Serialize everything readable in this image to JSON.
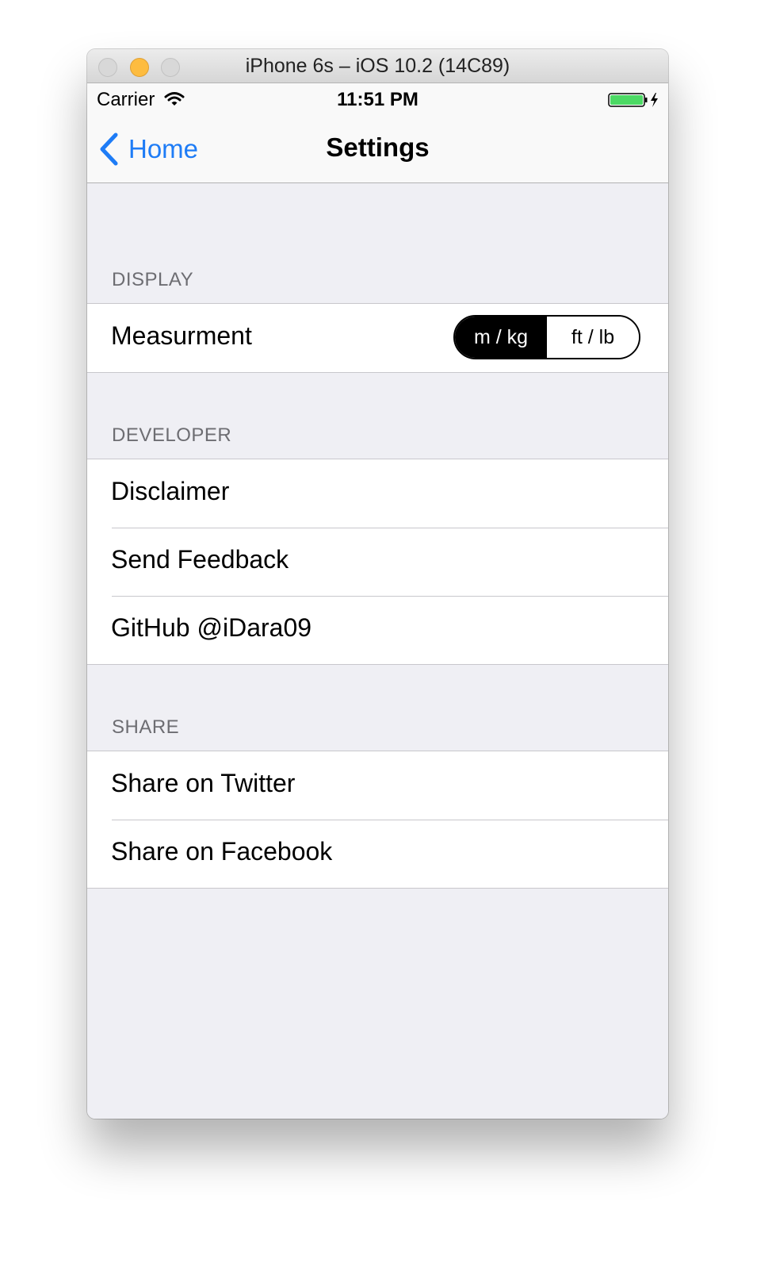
{
  "window": {
    "title": "iPhone 6s – iOS 10.2 (14C89)"
  },
  "status_bar": {
    "carrier": "Carrier",
    "time": "11:51 PM",
    "wifi_icon": "wifi-icon",
    "battery_icon": "battery-charging-icon",
    "battery_level": 1.0,
    "battery_color": "#4cd964"
  },
  "navbar": {
    "back_label": "Home",
    "back_icon": "chevron-left-icon",
    "title": "Settings",
    "accent_color": "#1e7cf6"
  },
  "sections": {
    "display": {
      "header": "DISPLAY",
      "measurement": {
        "label": "Measurment",
        "options": [
          "m / kg",
          "ft / lb"
        ],
        "selected": "m / kg"
      }
    },
    "developer": {
      "header": "DEVELOPER",
      "items": [
        "Disclaimer",
        "Send Feedback",
        "GitHub @iDara09"
      ]
    },
    "share": {
      "header": "SHARE",
      "items": [
        "Share on Twitter",
        "Share on Facebook"
      ]
    }
  }
}
